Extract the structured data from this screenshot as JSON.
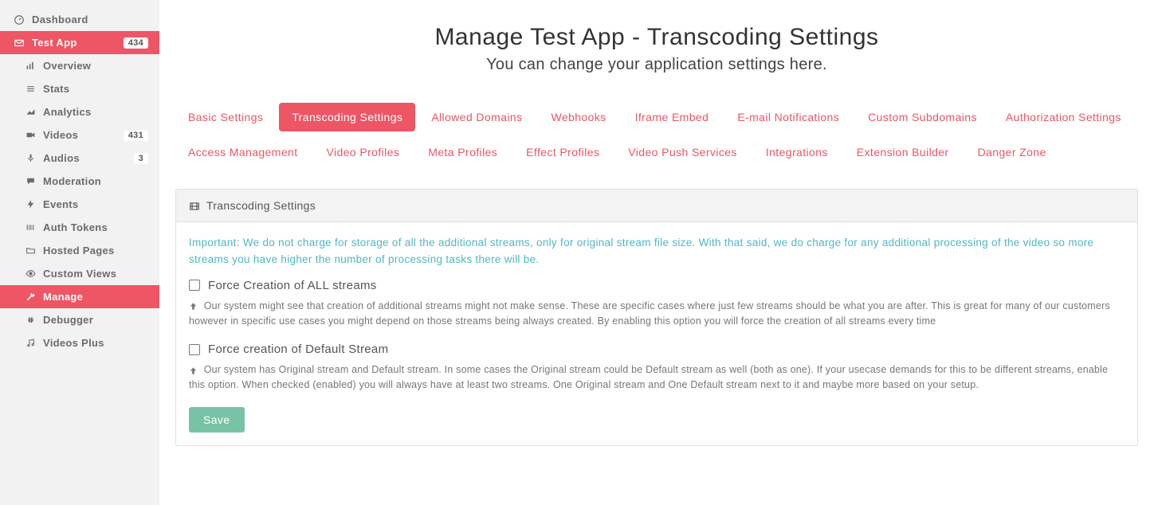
{
  "sidebar": {
    "dashboard": {
      "label": "Dashboard"
    },
    "test_app": {
      "label": "Test App",
      "badge": "434"
    },
    "items": [
      {
        "label": "Overview"
      },
      {
        "label": "Stats"
      },
      {
        "label": "Analytics"
      },
      {
        "label": "Videos",
        "badge": "431"
      },
      {
        "label": "Audios",
        "badge": "3"
      },
      {
        "label": "Moderation"
      },
      {
        "label": "Events"
      },
      {
        "label": "Auth Tokens"
      },
      {
        "label": "Hosted Pages"
      },
      {
        "label": "Custom Views"
      },
      {
        "label": "Manage"
      },
      {
        "label": "Debugger"
      },
      {
        "label": "Videos Plus"
      }
    ]
  },
  "header": {
    "title": "Manage Test App - Transcoding Settings",
    "subtitle": "You can change your application settings here."
  },
  "tabs": [
    "Basic Settings",
    "Transcoding Settings",
    "Allowed Domains",
    "Webhooks",
    "Iframe Embed",
    "E-mail Notifications",
    "Custom Subdomains",
    "Authorization Settings",
    "Access Management",
    "Video Profiles",
    "Meta Profiles",
    "Effect Profiles",
    "Video Push Services",
    "Integrations",
    "Extension Builder",
    "Danger Zone"
  ],
  "panel": {
    "title": "Transcoding Settings",
    "important": "Important: We do not charge for storage of all the additional streams, only for original stream file size. With that said, we do charge for any additional processing of the video so more streams you have higher the number of processing tasks there will be.",
    "option1": {
      "label": "Force Creation of ALL streams",
      "hint": "Our system might see that creation of additional streams might not make sense. These are specific cases where just few streams should be what you are after. This is great for many of our customers however in specific use cases you might depend on those streams being always created. By enabling this option you will force the creation of all streams every time"
    },
    "option2": {
      "label": "Force creation of Default Stream",
      "hint": "Our system has Original stream and Default stream. In some cases the Original stream could be Default stream as well (both as one). If your usecase demands for this to be different streams, enable this option. When checked (enabled) you will always have at least two streams. One Original stream and One Default stream next to it and maybe more based on your setup."
    },
    "save_label": "Save"
  }
}
